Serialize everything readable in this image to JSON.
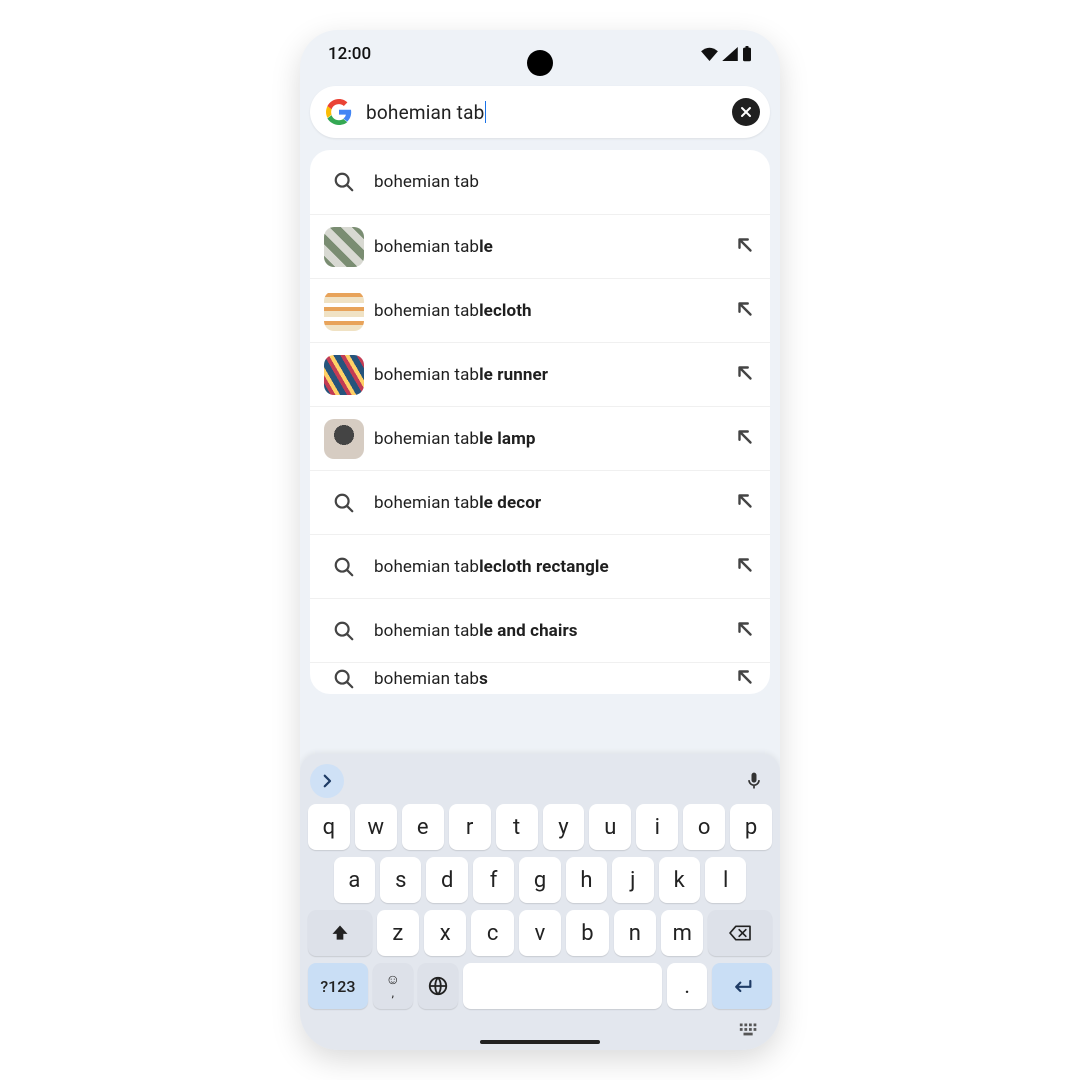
{
  "status": {
    "time": "12:00"
  },
  "search": {
    "query": "bohemian tab"
  },
  "suggestions": [
    {
      "prefix": "bohemian tab",
      "bold": "",
      "thumb": null
    },
    {
      "prefix": "bohemian tab",
      "bold": "le",
      "thumb": "a"
    },
    {
      "prefix": "bohemian tab",
      "bold": "lecloth",
      "thumb": "b"
    },
    {
      "prefix": "bohemian tab",
      "bold": "le runner",
      "thumb": "c"
    },
    {
      "prefix": "bohemian tab",
      "bold": "le lamp",
      "thumb": "d"
    },
    {
      "prefix": "bohemian tab",
      "bold": "le decor",
      "thumb": null
    },
    {
      "prefix": "bohemian tab",
      "bold": "lecloth rectangle",
      "thumb": null
    },
    {
      "prefix": "bohemian tab",
      "bold": "le and chairs",
      "thumb": null
    },
    {
      "prefix": "bohemian tab",
      "bold": "s",
      "thumb": null,
      "partial": true
    }
  ],
  "keyboard": {
    "numsym": "?123",
    "period": ".",
    "comma": ",",
    "rows": [
      [
        "q",
        "w",
        "e",
        "r",
        "t",
        "y",
        "u",
        "i",
        "o",
        "p"
      ],
      [
        "a",
        "s",
        "d",
        "f",
        "g",
        "h",
        "j",
        "k",
        "l"
      ],
      [
        "z",
        "x",
        "c",
        "v",
        "b",
        "n",
        "m"
      ]
    ]
  }
}
